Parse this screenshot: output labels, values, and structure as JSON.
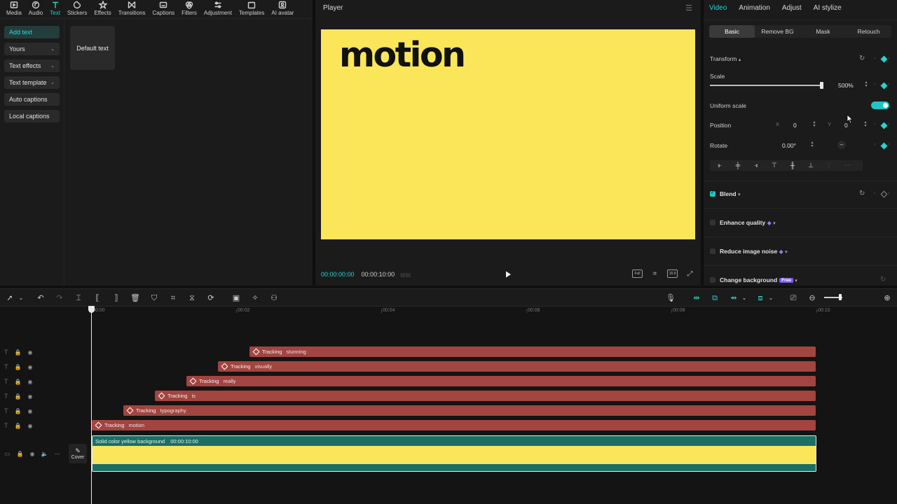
{
  "toolbar": {
    "items": [
      {
        "label": "Media",
        "icon": "media-icon"
      },
      {
        "label": "Audio",
        "icon": "audio-icon"
      },
      {
        "label": "Text",
        "icon": "text-icon"
      },
      {
        "label": "Stickers",
        "icon": "stickers-icon"
      },
      {
        "label": "Effects",
        "icon": "effects-icon"
      },
      {
        "label": "Transitions",
        "icon": "transitions-icon"
      },
      {
        "label": "Captions",
        "icon": "captions-icon"
      },
      {
        "label": "Filters",
        "icon": "filters-icon"
      },
      {
        "label": "Adjustment",
        "icon": "adjustment-icon"
      },
      {
        "label": "Templates",
        "icon": "templates-icon"
      },
      {
        "label": "AI avatar",
        "icon": "ai-avatar-icon"
      }
    ],
    "active": "Text"
  },
  "left_nav": {
    "items": [
      "Add text",
      "Yours",
      "Text effects",
      "Text template",
      "Auto captions",
      "Local captions"
    ],
    "active": "Add text",
    "default_text_card": "Default text"
  },
  "player": {
    "title": "Player",
    "canvas_text": "motion",
    "canvas_color": "#fbe65a",
    "current_time": "00:00:00:00",
    "duration": "00:00:10:00",
    "ratio_label": "16:9",
    "full_label": "Full"
  },
  "inspector": {
    "tabs": [
      "Video",
      "Animation",
      "Adjust",
      "AI stylize"
    ],
    "active_tab": "Video",
    "sub_tabs": [
      "Basic",
      "Remove BG",
      "Mask",
      "Retouch"
    ],
    "active_sub_tab": "Basic",
    "transform_label": "Transform",
    "scale_label": "Scale",
    "scale_value": "500%",
    "uniform_scale_label": "Uniform scale",
    "position_label": "Position",
    "pos_x_label": "X",
    "pos_x": "0",
    "pos_y_label": "Y",
    "pos_y": "0",
    "rotate_label": "Rotate",
    "rotate_value": "0.00°",
    "blend_label": "Blend",
    "enhance_quality_label": "Enhance quality",
    "reduce_noise_label": "Reduce image noise",
    "change_background_label": "Change background",
    "free_badge": "Free",
    "accent_color": "#27d3cf"
  },
  "timeline": {
    "ruler_labels": [
      "00:00",
      "00:02",
      "00:04",
      "00:06",
      "00:08",
      "00:10"
    ],
    "text_tracks": [
      {
        "effect": "Tracking",
        "name": "stunning"
      },
      {
        "effect": "Tracking",
        "name": "visually"
      },
      {
        "effect": "Tracking",
        "name": "really"
      },
      {
        "effect": "Tracking",
        "name": "is"
      },
      {
        "effect": "Tracking",
        "name": "typography"
      },
      {
        "effect": "Tracking",
        "name": "motion"
      }
    ],
    "video_clip_name": "Solid color yellow background",
    "video_clip_duration": "00:00:10:00",
    "cover_label": "Cover",
    "clip_color": "#a2443f"
  }
}
